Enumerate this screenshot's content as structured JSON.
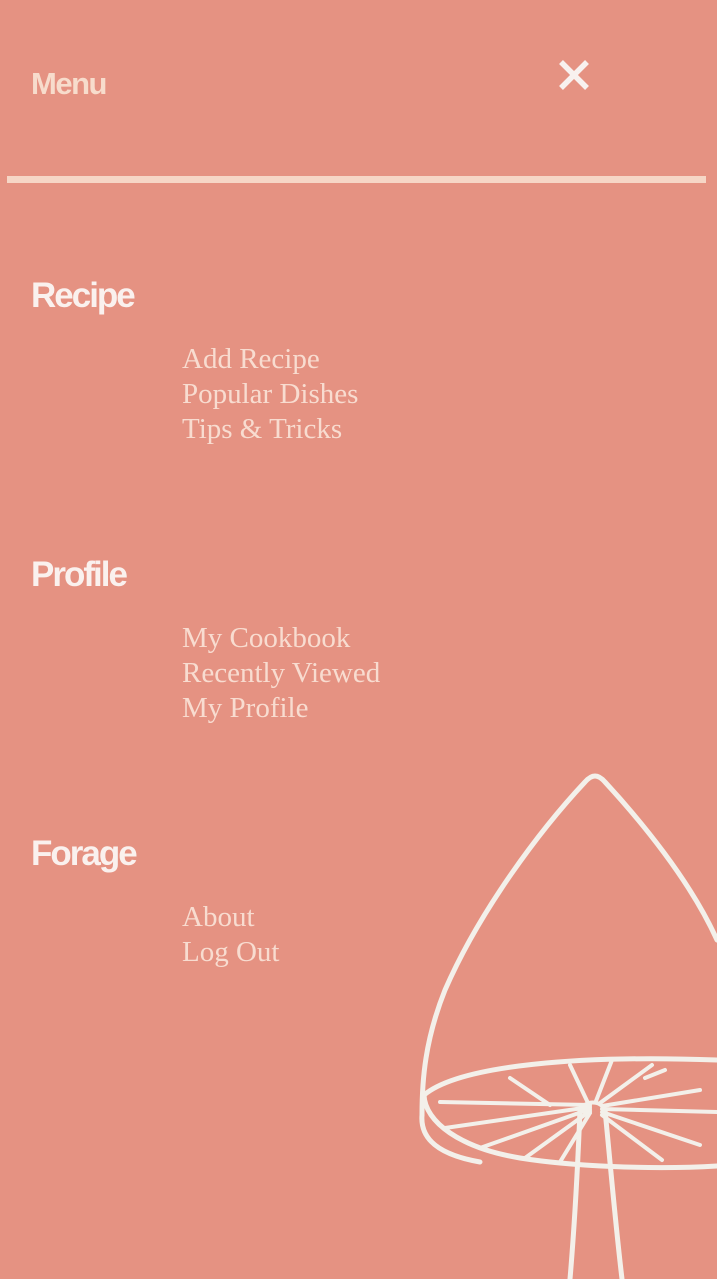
{
  "header": {
    "title": "Menu",
    "close_icon": "close-icon"
  },
  "sections": [
    {
      "heading": "Recipe",
      "links": [
        "Add Recipe",
        "Popular Dishes",
        "Tips & Tricks"
      ]
    },
    {
      "heading": "Profile",
      "links": [
        "My Cookbook",
        "Recently Viewed",
        "My Profile"
      ]
    },
    {
      "heading": "Forage",
      "links": [
        "About",
        "Log Out"
      ]
    }
  ],
  "decoration": {
    "icon": "mushroom-illustration"
  },
  "colors": {
    "background": "#e59282",
    "title": "#f7dccc",
    "heading": "#faf1ee",
    "link": "#f8dcd0",
    "divider": "#f6d6c6",
    "illustration": "#f3f0ea"
  }
}
